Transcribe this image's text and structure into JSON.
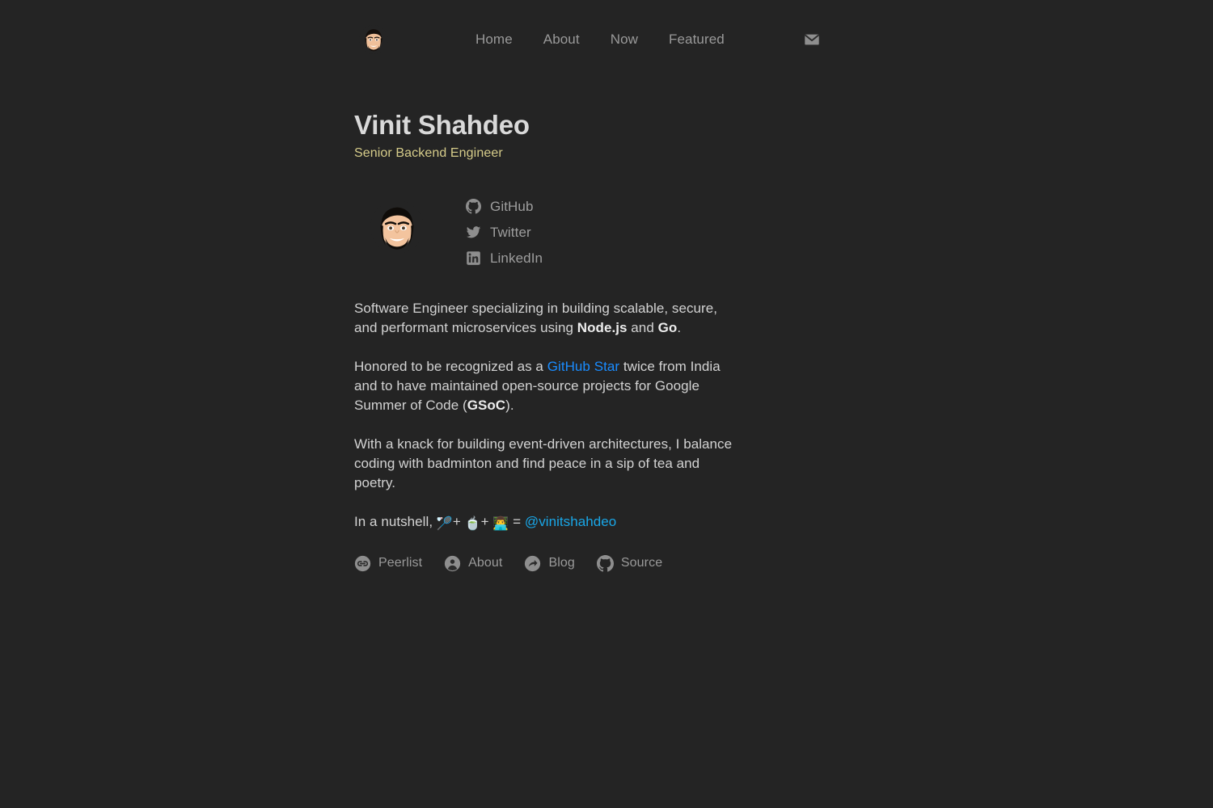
{
  "theme": {
    "background": "#242424",
    "title_color": "#d9d9d9",
    "subtitle_color": "#d6cc8a",
    "body_color": "#d3d3d3",
    "muted_color": "#9a9a9a",
    "link_blue": "#1a8cff",
    "link_cyan": "#19a7e8",
    "icon_gray": "#8c8c8c"
  },
  "header": {
    "brand_avatar_alt": "avatar-illustration",
    "nav": [
      {
        "label": "Home"
      },
      {
        "label": "About"
      },
      {
        "label": "Now"
      },
      {
        "label": "Featured"
      }
    ],
    "mail_icon": "mail-icon"
  },
  "hero": {
    "title": "Vinit Shahdeo",
    "subtitle": "Senior Backend Engineer"
  },
  "profile": {
    "photo_alt": "profile-avatar-illustration",
    "socials": [
      {
        "label": "GitHub",
        "icon": "github-icon"
      },
      {
        "label": "Twitter",
        "icon": "twitter-icon"
      },
      {
        "label": "LinkedIn",
        "icon": "linkedin-icon"
      }
    ]
  },
  "bio": {
    "p1_a": "Software Engineer specializing in building scalable, secure, and performant microservices using ",
    "p1_nodejs": "Node.js",
    "p1_b": " and ",
    "p1_go": "Go",
    "p1_c": ".",
    "p2_a": "Honored to be recognized as a ",
    "p2_link": "GitHub Star",
    "p2_b": " twice from India and to have maintained open-source projects for Google Summer of Code (",
    "p2_gsoc": "GSoC",
    "p2_c": ").",
    "p3": "With a knack for building event-driven architectures, I balance coding with badminton and find peace in a sip of tea and poetry.",
    "p4_a": "In a nutshell, ",
    "p4_emoji1": "🏸",
    "p4_plus1": "+ ",
    "p4_emoji2": "🍵",
    "p4_plus2": "+ ",
    "p4_emoji3": "👨‍💻",
    "p4_equals": " = ",
    "p4_handle": "@vinitshahdeo"
  },
  "footer": {
    "links": [
      {
        "label": "Peerlist",
        "icon": "peerlist-icon"
      },
      {
        "label": "About",
        "icon": "person-circle-icon"
      },
      {
        "label": "Blog",
        "icon": "share-arrow-circle-icon"
      },
      {
        "label": "Source",
        "icon": "github-icon"
      }
    ]
  }
}
